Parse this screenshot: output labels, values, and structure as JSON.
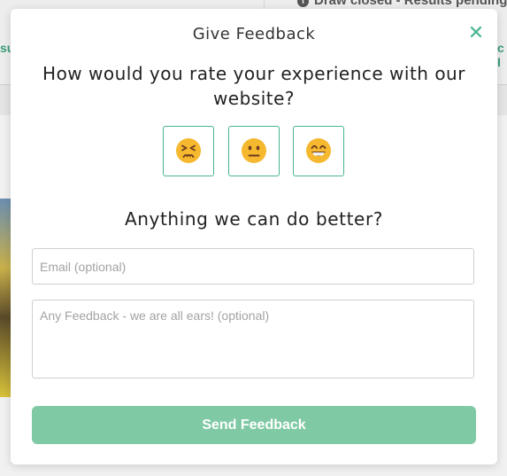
{
  "background": {
    "status_text": "Draw closed - Results pending",
    "left_teal_text": "su",
    "right_teal_text": "c I"
  },
  "modal": {
    "title": "Give Feedback",
    "close_label": "✕",
    "question": "How would you rate your experience with our website?",
    "ratings": [
      {
        "name": "unhappy-face-icon"
      },
      {
        "name": "neutral-face-icon"
      },
      {
        "name": "happy-face-icon"
      }
    ],
    "subquestion": "Anything we can do better?",
    "email_placeholder": "Email (optional)",
    "feedback_placeholder": "Any Feedback - we are all ears! (optional)",
    "send_label": "Send Feedback"
  },
  "colors": {
    "accent": "#49b58d",
    "button": "#7fc9a4",
    "emoji": "#f5b82e"
  }
}
